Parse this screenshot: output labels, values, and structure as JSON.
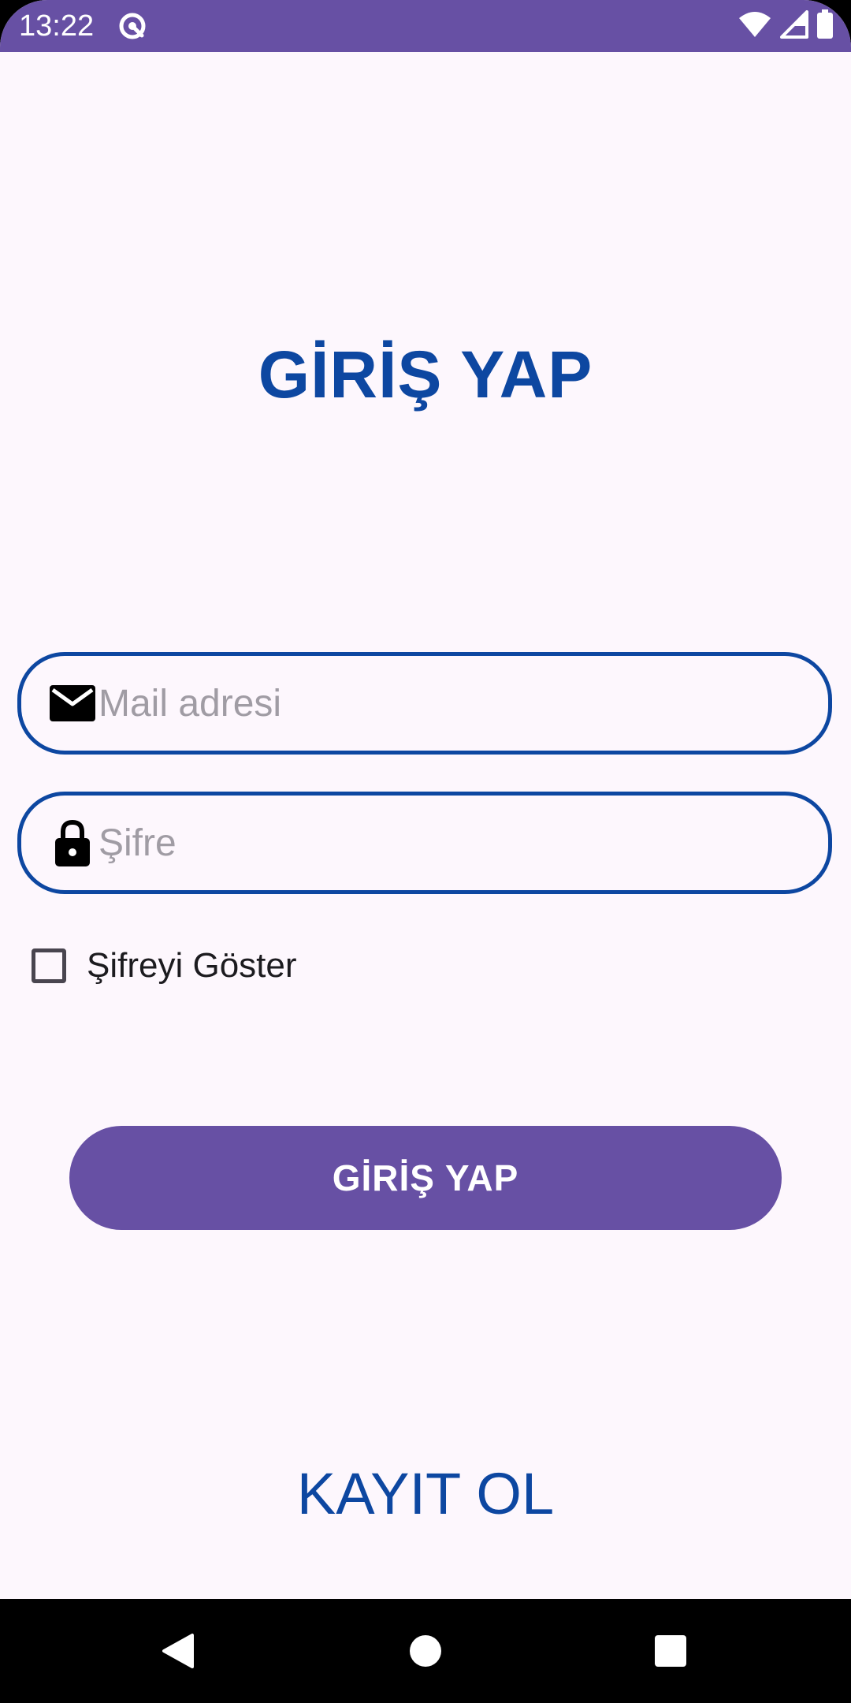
{
  "status_bar": {
    "time": "13:22",
    "color": "#6750A4",
    "app_icon": "sync-circle-icon",
    "icons": [
      "wifi-icon",
      "signal-icon",
      "battery-icon"
    ]
  },
  "title": "GİRİŞ YAP",
  "email_field": {
    "icon": "mail-icon",
    "placeholder": "Mail adresi",
    "value": ""
  },
  "password_field": {
    "icon": "lock-icon",
    "placeholder": "Şifre",
    "value": ""
  },
  "show_password": {
    "label": "Şifreyi Göster",
    "checked": false
  },
  "login_button": {
    "label": "GİRİŞ YAP",
    "color": "#6750A4"
  },
  "register_link": {
    "label": "KAYIT OL",
    "color": "#0D47A1"
  },
  "nav_bar": {
    "icons": [
      "back-icon",
      "home-icon",
      "recents-icon"
    ]
  }
}
